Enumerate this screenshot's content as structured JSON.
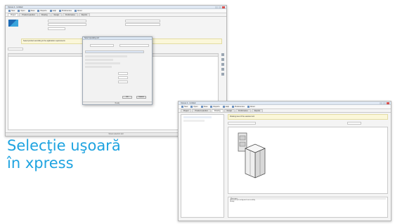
{
  "caption": {
    "line1": "Selecţie uşoară",
    "line2": "în xpress"
  },
  "colors": {
    "caption": "#1ea3e0",
    "window_bg": "#f4f4f4",
    "titlebar": "#dfe8f3",
    "info_bar": "#fbf7d9"
  },
  "icons": [
    "app-logo-icon",
    "toolbar-icon",
    "window-close-icon",
    "product-drawing-icon"
  ],
  "window1": {
    "title": "Xpress 2 - Untitled",
    "toolbar": [
      "New",
      "Open",
      "Save",
      "Reports",
      "Help",
      "Preferences",
      "About"
    ],
    "tabs": [
      "Project",
      "Product selection",
      "Drawing",
      "Design",
      "Performance",
      "Reports"
    ],
    "info_bar": "Select product according to the application requirements",
    "statusbar": "Xpress selection tool"
  },
  "dialog": {
    "title": "Select operating unit",
    "ok": "OK",
    "cancel": "Cancel",
    "footer": "Ready"
  },
  "window2": {
    "title": "Xpress 2 - Untitled",
    "toolbar": [
      "New",
      "Open",
      "Save",
      "Reports",
      "Help",
      "Preferences",
      "About"
    ],
    "tabs": [
      "Project",
      "Product selection",
      "Drawing",
      "Design",
      "Performance",
      "Reports"
    ],
    "info_bar": "Drawing view of the selected unit",
    "bottom_panel_title": "Messages",
    "bottom_panel_line1": "Selected unit configured successfully",
    "bottom_panel_line2": "Ready"
  }
}
